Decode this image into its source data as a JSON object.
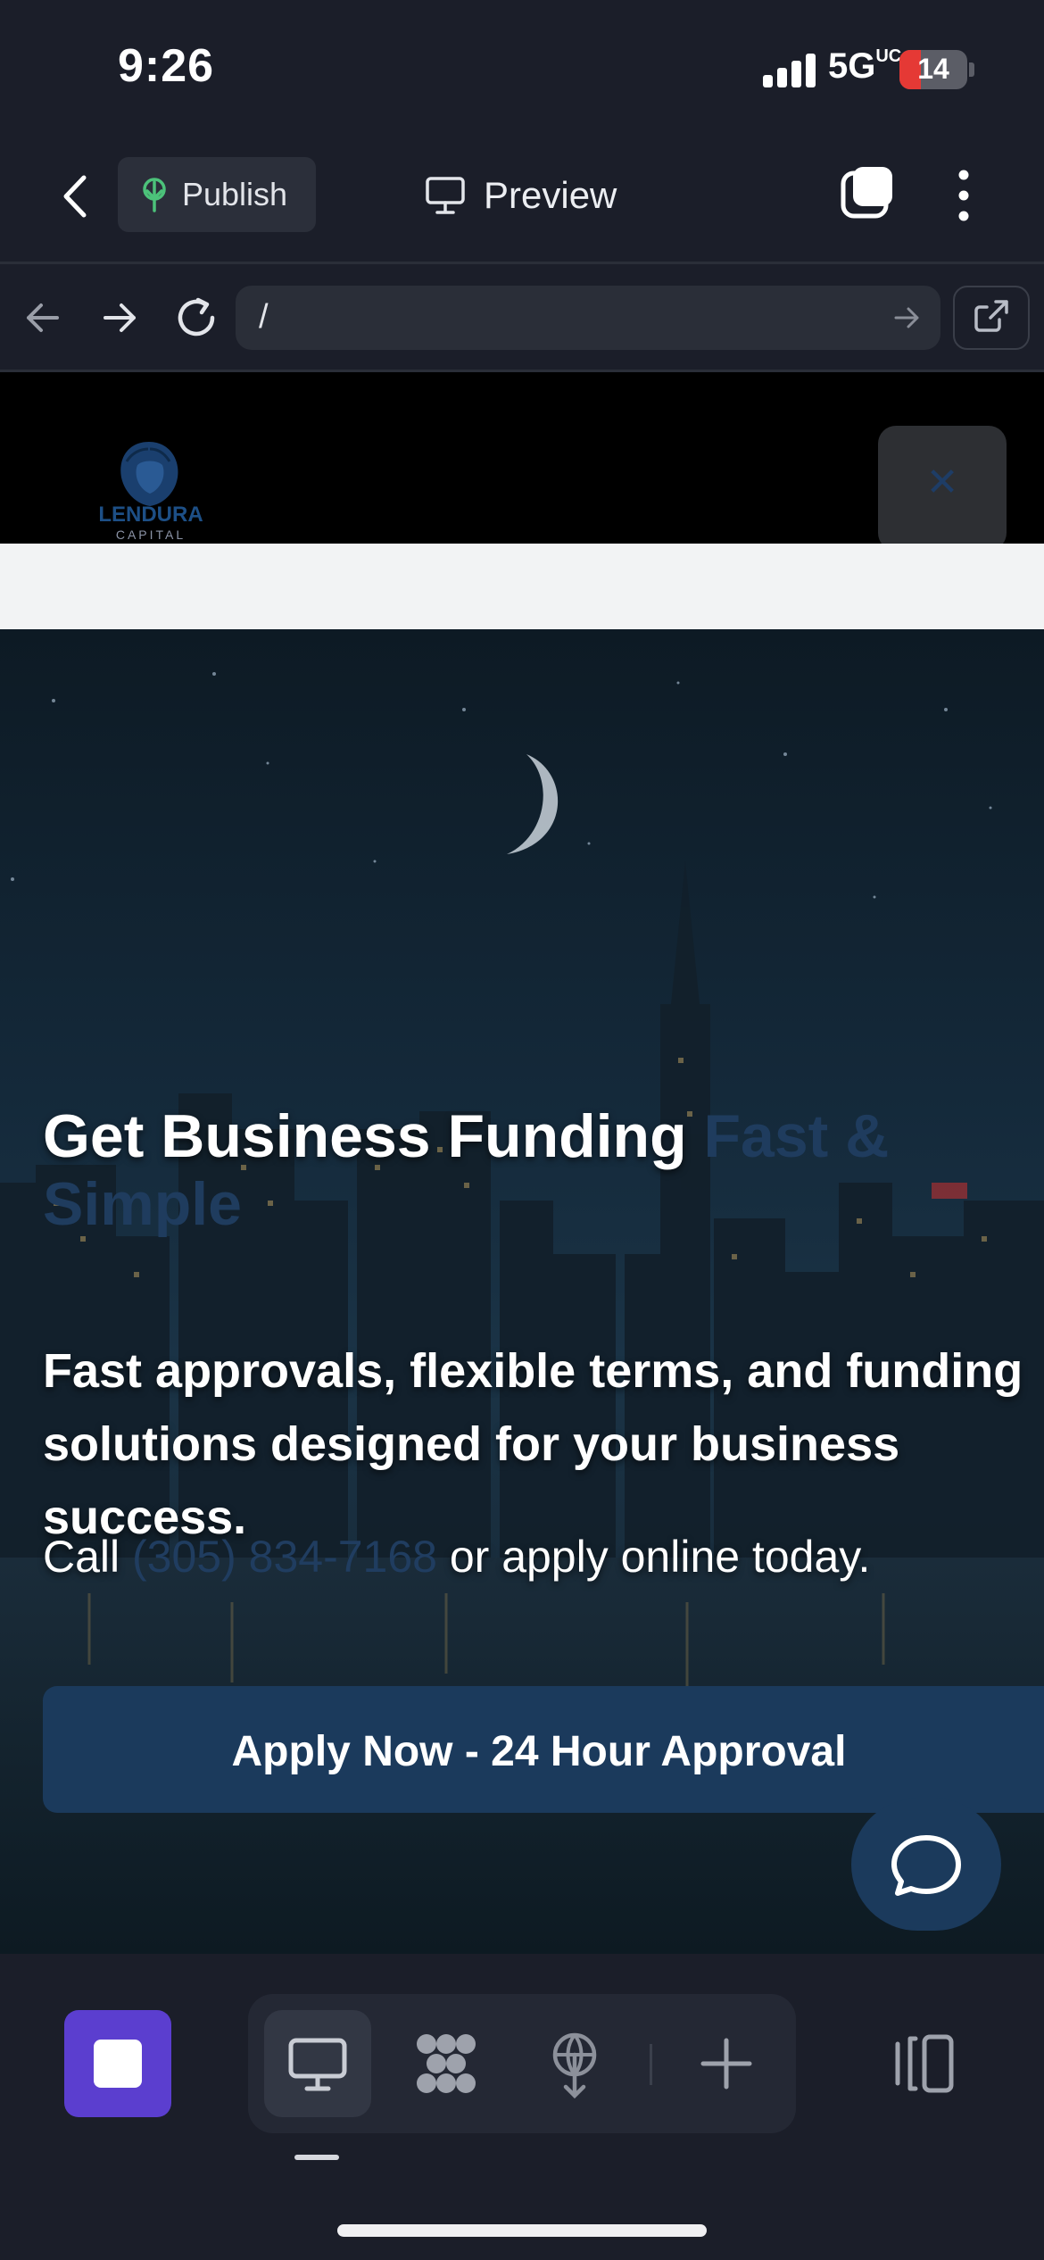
{
  "status_bar": {
    "time": "9:26",
    "network": "5G",
    "network_super": "UC",
    "battery": "14"
  },
  "topbar": {
    "publish_label": "Publish",
    "preview_label": "Preview"
  },
  "browser": {
    "url": "/"
  },
  "site": {
    "logo_text": "LENDURA",
    "logo_sub": "CAPITAL",
    "close_label": "✕",
    "hero": {
      "title_main": "Get Business Funding ",
      "title_accent": "Fast & Simple",
      "subtitle": "Fast approvals, flexible terms, and funding solutions designed for your business success.",
      "call_prefix": "Call ",
      "phone": "(305) 834-7168",
      "call_suffix": " or apply online today.",
      "cta_label": "Apply Now - 24 Hour Approval"
    }
  },
  "bottom_toolbar": {
    "tools": [
      "desktop-icon",
      "components-icon",
      "publish-icon",
      "add-icon",
      "panel-icon"
    ]
  },
  "colors": {
    "accent": "#5b3ecf",
    "brand_blue": "#1b3a5c",
    "publish_green": "#4cc27a"
  }
}
